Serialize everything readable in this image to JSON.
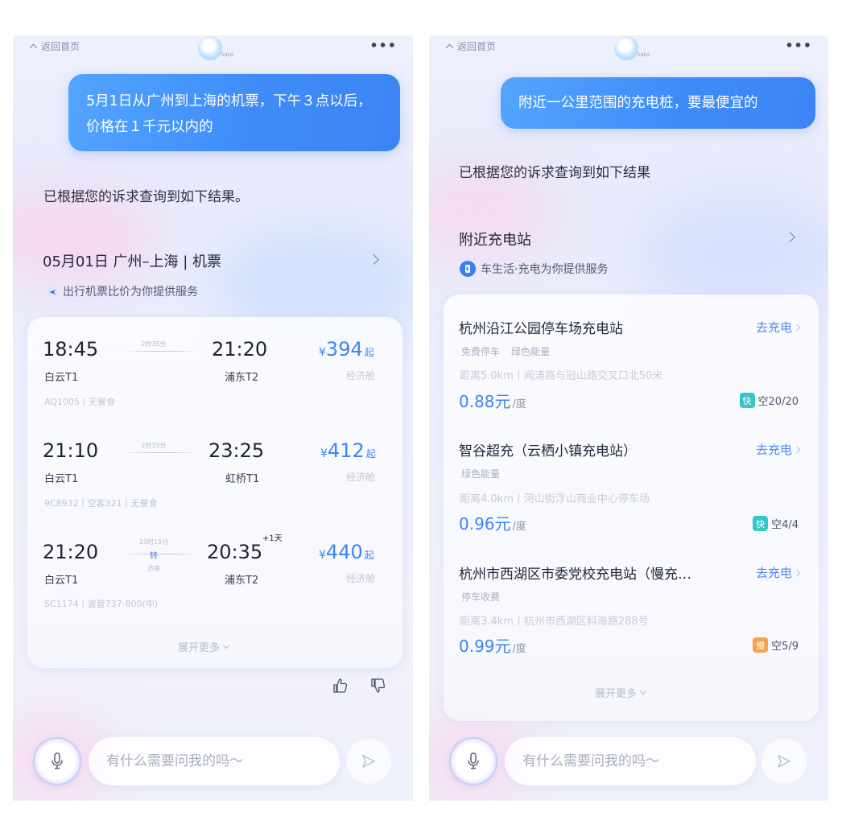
{
  "left": {
    "topbar": {
      "back_label": "返回首页",
      "logo_text": "Sato",
      "more_label": "•••"
    },
    "user_message": "5月1日从广州到上海的机票，下午３点以后，价格在１千元以内的",
    "reply": "已根据您的诉求查询到如下结果。",
    "card": {
      "title": "05月01日 广州–上海 | 机票",
      "provider": "出行机票比价为你提供服务",
      "flights": [
        {
          "dep_time": "18:45",
          "dep_term": "白云T1",
          "duration": "2时35分",
          "arr_time": "21:20",
          "arr_term": "浦东T2",
          "price_currency": "¥",
          "price": "394",
          "price_suffix": "起",
          "cabin": "经济舱",
          "info": "AQ1005丨无餐食",
          "transfer": "",
          "transfer_sub": "",
          "plus_day": ""
        },
        {
          "dep_time": "21:10",
          "dep_term": "白云T1",
          "duration": "2时15分",
          "arr_time": "23:25",
          "arr_term": "虹桥T1",
          "price_currency": "¥",
          "price": "412",
          "price_suffix": "起",
          "cabin": "经济舱",
          "info": "9C8932丨空客321丨无餐食",
          "transfer": "",
          "transfer_sub": "",
          "plus_day": ""
        },
        {
          "dep_time": "21:20",
          "dep_term": "白云T1",
          "duration": "23时15分",
          "arr_time": "20:35",
          "arr_term": "浦东T2",
          "price_currency": "¥",
          "price": "440",
          "price_suffix": "起",
          "cabin": "经济舱",
          "info": "SC1174丨波音737-800(中)",
          "transfer": "转",
          "transfer_sub": "济南",
          "plus_day": "+1天"
        }
      ],
      "expand_label": "展开更多"
    },
    "input_placeholder": "有什么需要问我的吗～"
  },
  "right": {
    "topbar": {
      "back_label": "返回首页",
      "logo_text": "Sato",
      "more_label": "•••"
    },
    "user_message": "附近一公里范围的充电桩，要最便宜的",
    "reply": "已根据您的诉求查询到如下结果",
    "card": {
      "title": "附近充电站",
      "provider": "车生活·充电为你提供服务",
      "stations": [
        {
          "name": "杭州沿江公园停车场充电站",
          "go_label": "去充电",
          "tags": [
            "免费停车",
            "绿色能量"
          ],
          "distance": "距离5.0km丨闻涛路与冠山路交叉口北50米",
          "price": "0.88元",
          "unit": "/度",
          "badge": "快",
          "badge_color": "#36c5c9",
          "availability": "空20/20"
        },
        {
          "name": "智谷超充（云栖小镇充电站）",
          "go_label": "去充电",
          "tags": [
            "绿色能量"
          ],
          "distance": "距离4.0km丨河山街浮山商业中心停车场",
          "price": "0.96元",
          "unit": "/度",
          "badge": "快",
          "badge_color": "#36c5c9",
          "availability": "空4/4"
        },
        {
          "name": "杭州市西湖区市委党校充电站（慢充…",
          "go_label": "去充电",
          "tags": [
            "停车收费"
          ],
          "distance": "距离3.4km丨杭州市西湖区科海路288号",
          "price": "0.99元",
          "unit": "/度",
          "badge": "慢",
          "badge_color": "#f5a34b",
          "availability": "空5/9"
        }
      ],
      "expand_label": "展开更多"
    },
    "input_placeholder": "有什么需要问我的吗～"
  },
  "colors": {
    "accent": "#3d86f5",
    "bubble": "#4690fa"
  },
  "icons": [
    "chevron-up-icon",
    "more-icon",
    "logo-icon",
    "chevron-right-icon",
    "plane-icon",
    "charger-icon",
    "thumbs-up-icon",
    "thumbs-down-icon",
    "mic-icon",
    "send-icon"
  ]
}
